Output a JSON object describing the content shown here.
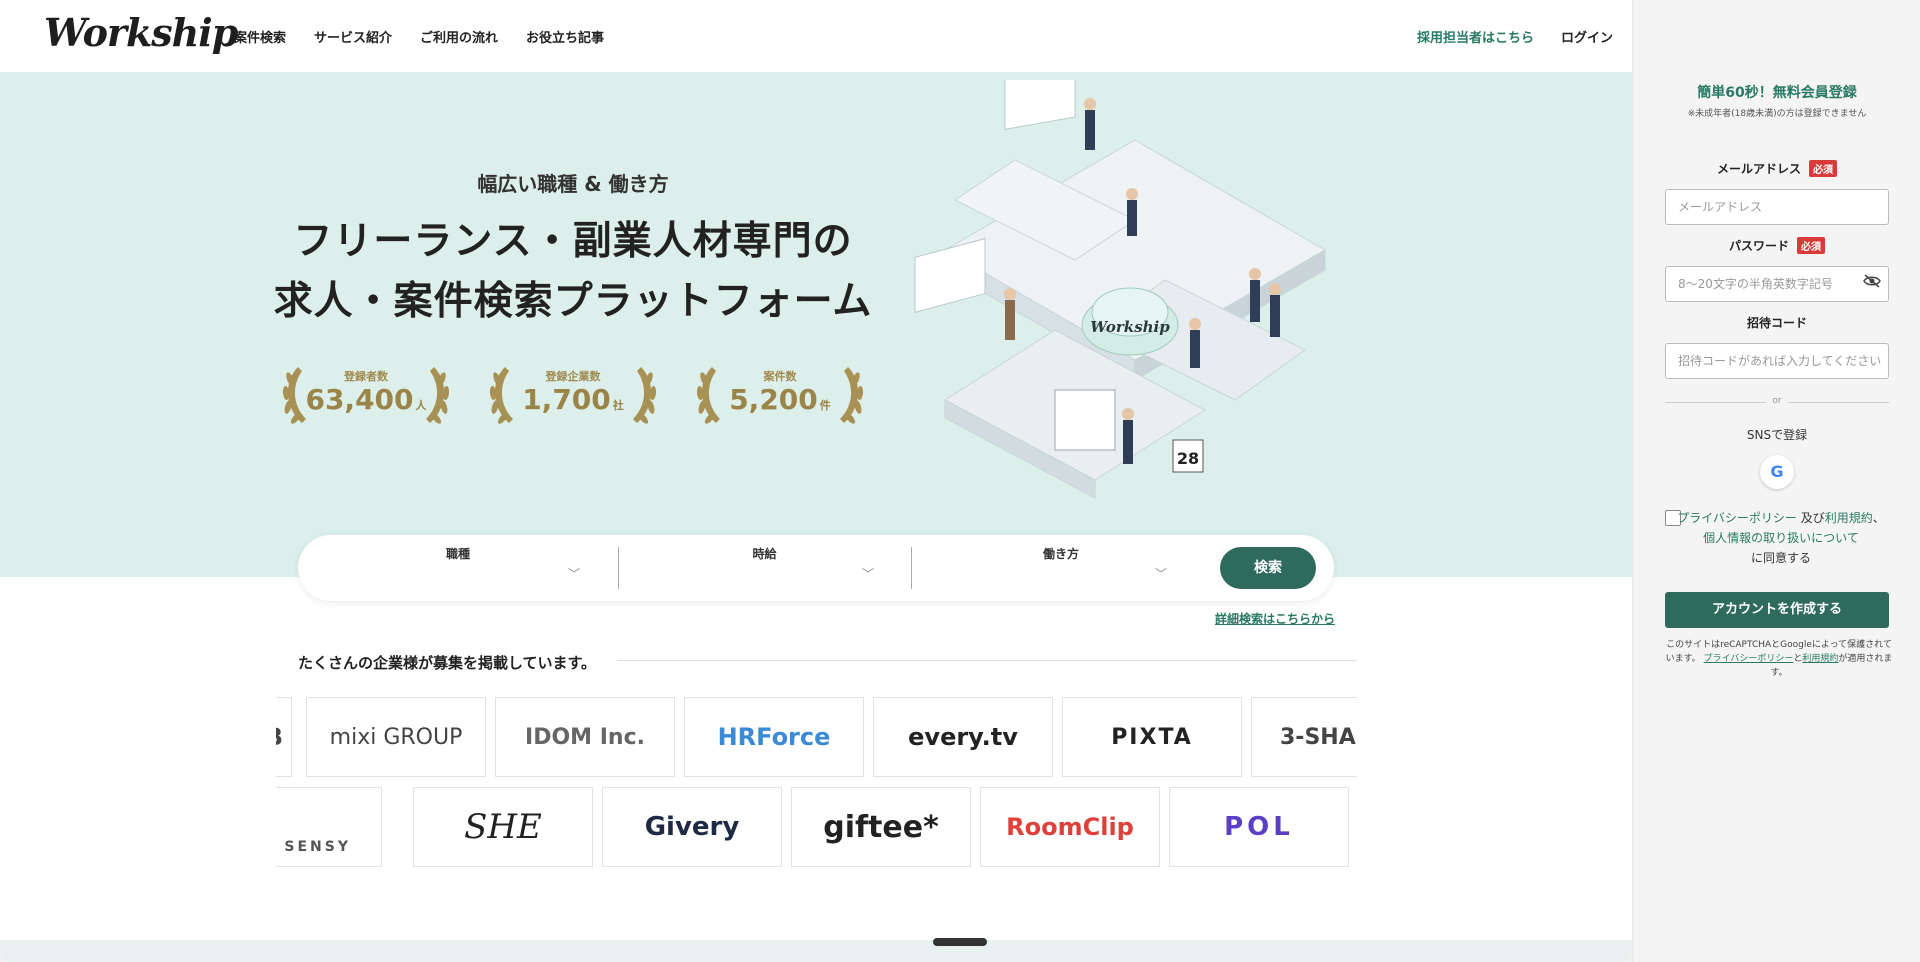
{
  "header": {
    "logo": "Workship",
    "nav": [
      "案件検索",
      "サービス紹介",
      "ご利用の流れ",
      "お役立ち記事"
    ],
    "recruit_link": "採用担当者はこちら",
    "login": "ログイン"
  },
  "hero": {
    "subtitle": "幅広い職種 & 働き方",
    "title_line1": "フリーランス・副業人材専門の",
    "title_line2": "求人・案件検索プラットフォーム",
    "stats": [
      {
        "label": "登録者数",
        "value": "63,400",
        "unit": "人"
      },
      {
        "label": "登録企業数",
        "value": "1,700",
        "unit": "社"
      },
      {
        "label": "案件数",
        "value": "5,200",
        "unit": "件"
      }
    ],
    "illustration_sign": "Workship",
    "calendar_day": "28"
  },
  "search": {
    "fields": [
      "職種",
      "時給",
      "働き方"
    ],
    "button": "検索",
    "detail_link": "詳細検索はこちらから"
  },
  "companies": {
    "heading": "たくさんの企業様が募集を掲載しています。",
    "row1": [
      "B",
      "mixi GROUP",
      "IDOM Inc.",
      "HRForce",
      "every.tv",
      "PIXTA",
      "3-SHA"
    ],
    "row2": [
      "SENSY",
      "SHE",
      "Givery",
      "giftee*",
      "RoomClip",
      "POL"
    ]
  },
  "panel": {
    "title": "簡単60秒！無料会員登録",
    "note": "※未成年者(18歳未満)の方は登録できません",
    "email_label": "メールアドレス",
    "required": "必須",
    "email_placeholder": "メールアドレス",
    "password_label": "パスワード",
    "password_placeholder": "8〜20文字の半角英数字記号",
    "invite_label": "招待コード",
    "invite_placeholder": "招待コードがあれば入力してください",
    "or": "or",
    "sns_label": "SNSで登録",
    "google": "G",
    "agree_privacy": "プライバシーポリシー",
    "agree_and": "及び",
    "agree_terms": "利用規約",
    "agree_sep": "、",
    "agree_personal": "個人情報の取り扱いについて",
    "agree_suffix": "に同意する",
    "create_button": "アカウントを作成する",
    "legal_prefix": "このサイトはreCAPTCHAとGoogleによって保護されています。",
    "legal_privacy": "プライバシーポリシー",
    "legal_and": "と",
    "legal_terms": "利用規約",
    "legal_suffix": "が適用されます。"
  },
  "colors": {
    "accent": "#2e6b5c",
    "link": "#2a7a63",
    "hero_bg": "#dcefeb",
    "gold": "#9b8447",
    "required": "#d93b3b"
  },
  "icons": [
    "chevron-down-icon",
    "eye-slash-icon",
    "google-icon",
    "laurel-icon"
  ]
}
